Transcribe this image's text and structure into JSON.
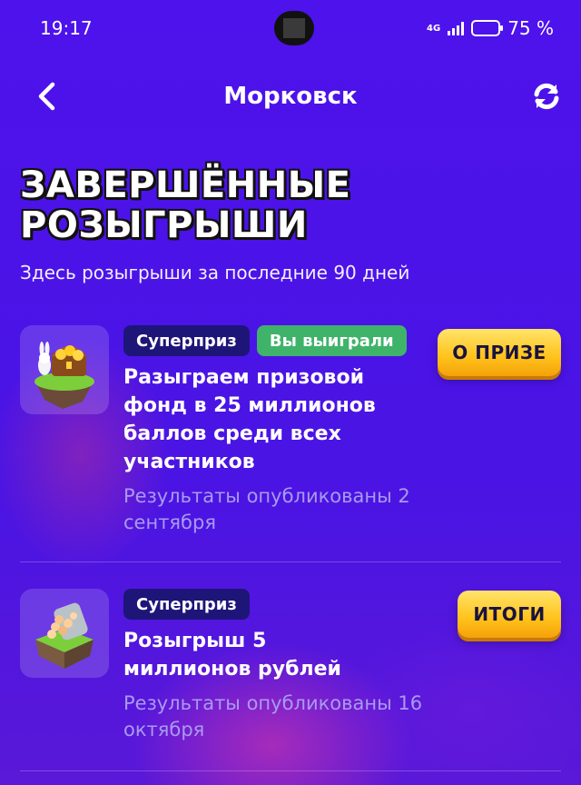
{
  "status_bar": {
    "time": "19:17",
    "network": "4G",
    "battery_percent": 75,
    "battery_label": "75 %"
  },
  "nav": {
    "back_icon": "chevron-left-icon",
    "title": "Морковск",
    "refresh_icon": "refresh-icon"
  },
  "page": {
    "heading_line1": "ЗАВЕРШЁННЫЕ",
    "heading_line2": "РОЗЫГРЫШИ",
    "subtitle": "Здесь розыгрыши за последние 90 дней"
  },
  "draws": [
    {
      "badge_type": "Суперприз",
      "badge_status": "Вы выиграли",
      "title": "Разыграем призовой фонд в 25 миллионов баллов среди всех участников",
      "meta": "Результаты опубликованы 2 сентября",
      "cta": "О ПРИЗЕ",
      "thumb_icon": "treasure-chest-island-icon"
    },
    {
      "badge_type": "Суперприз",
      "title": "Розыгрыш 5 миллионов рублей",
      "meta": "Результаты опубликованы 16 октября",
      "cta": "ИТОГИ",
      "thumb_icon": "coin-jar-island-icon"
    }
  ],
  "colors": {
    "background": "#4b14e6",
    "badge_super": "#1e1578",
    "badge_win": "#3fb36a",
    "cta_yellow": "#ffc21a",
    "meta_text": "#a99af0"
  }
}
